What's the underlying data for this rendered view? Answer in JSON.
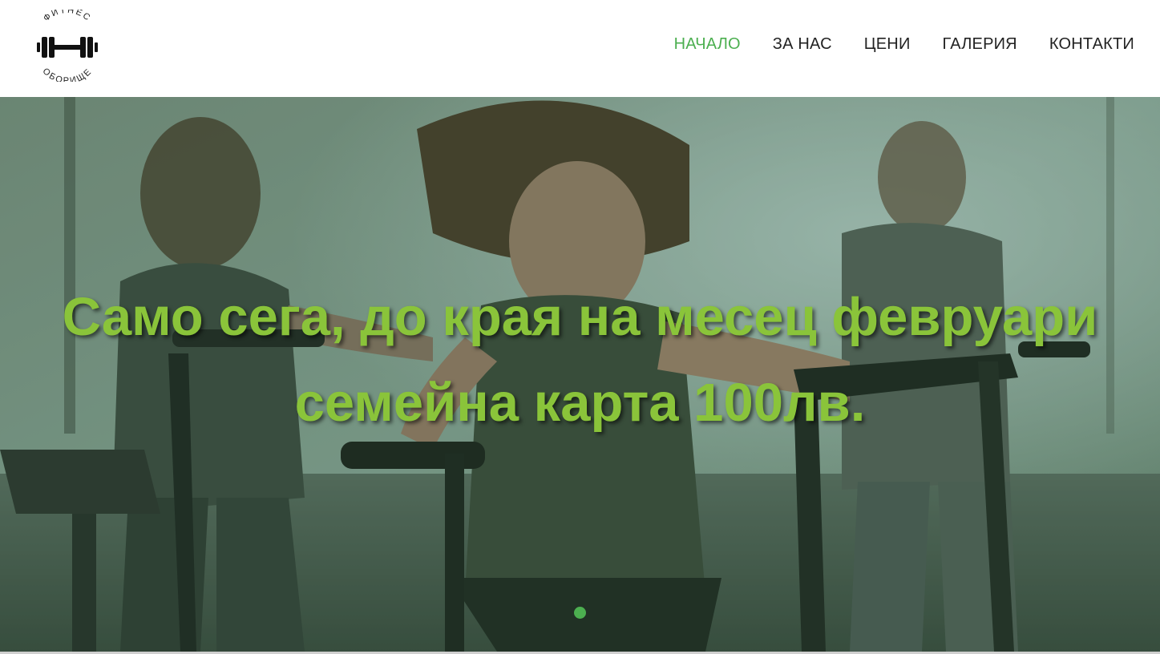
{
  "brand": {
    "top_text": "ФИТНЕС",
    "bottom_text": "ОБОРИЩЕ",
    "icon": "dumbbell-icon"
  },
  "nav": {
    "items": [
      {
        "label": "НАЧАЛО",
        "active": true
      },
      {
        "label": "ЗА НАС",
        "active": false
      },
      {
        "label": "ЦЕНИ",
        "active": false
      },
      {
        "label": "ГАЛЕРИЯ",
        "active": false
      },
      {
        "label": "КОНТАКТИ",
        "active": false
      }
    ]
  },
  "hero": {
    "line1": "Само сега, до края на месец февруари",
    "line2": "семейна карта 100лв.",
    "slide_indicator": {
      "count": 1,
      "active_index": 0
    }
  },
  "colors": {
    "accent": "#4caf50",
    "headline": "#8ac43a",
    "nav_text": "#222222"
  }
}
